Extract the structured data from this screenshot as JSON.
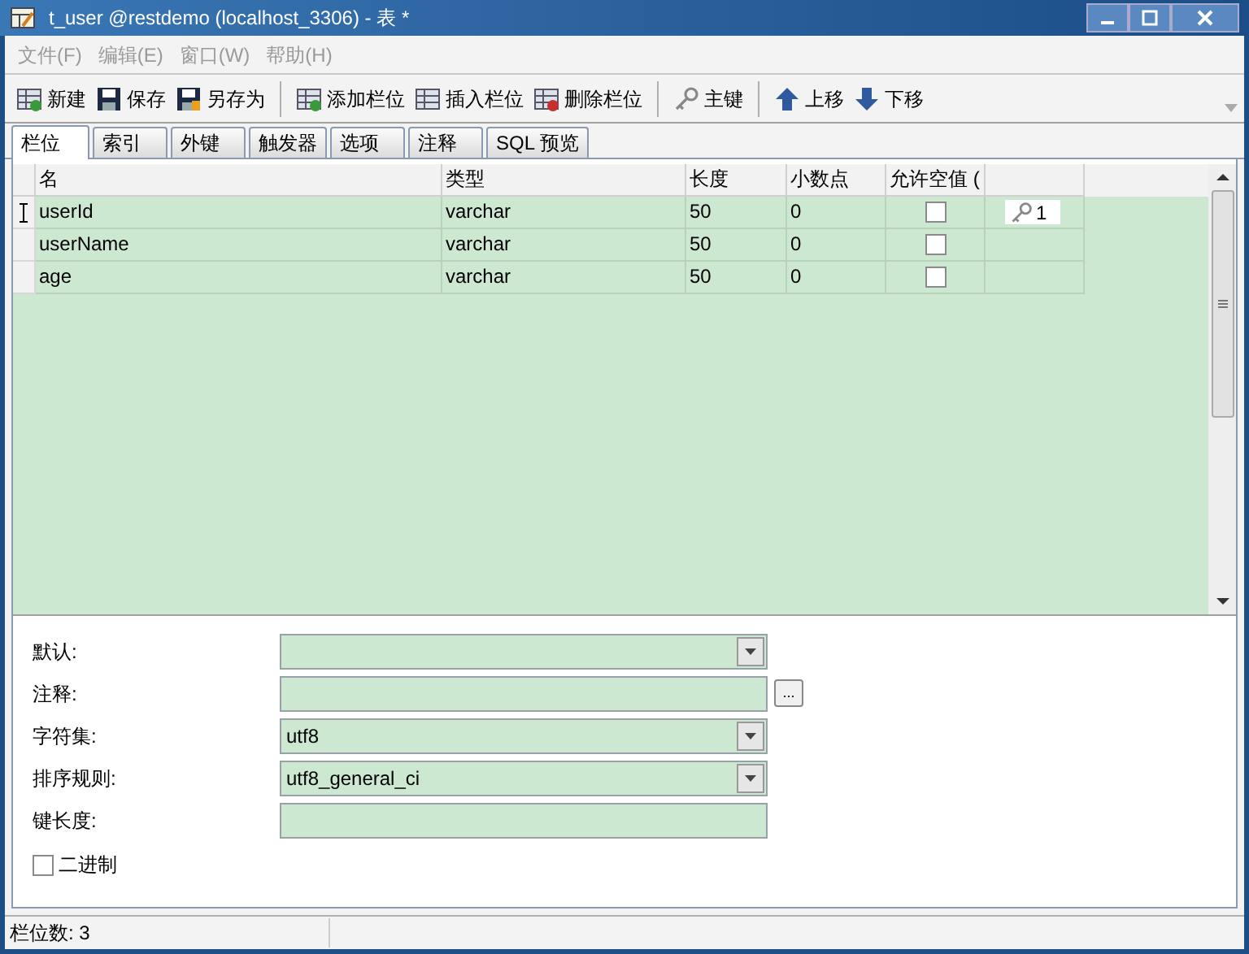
{
  "window": {
    "title": "t_user @restdemo (localhost_3306) - 表 *"
  },
  "menu": [
    {
      "label": "文件(F)",
      "disabled": true
    },
    {
      "label": "编辑(E)",
      "disabled": true
    },
    {
      "label": "窗口(W)",
      "disabled": true
    },
    {
      "label": "帮助(H)",
      "disabled": true
    }
  ],
  "toolbar": {
    "groups": [
      [
        "新建",
        "保存",
        "另存为"
      ],
      [
        "添加栏位",
        "插入栏位",
        "删除栏位"
      ],
      [
        "主键"
      ],
      [
        "上移",
        "下移"
      ]
    ]
  },
  "tabs": [
    {
      "label": "栏位",
      "selected": true
    },
    {
      "label": "索引",
      "selected": false
    },
    {
      "label": "外键",
      "selected": false
    },
    {
      "label": "触发器",
      "selected": false
    },
    {
      "label": "选项",
      "selected": false
    },
    {
      "label": "注释",
      "selected": false
    },
    {
      "label": "SQL 预览",
      "selected": false
    }
  ],
  "table": {
    "columns": [
      "名",
      "类型",
      "长度",
      "小数点",
      "允许空值 (",
      ""
    ],
    "rows": [
      {
        "current": true,
        "name": "userId",
        "type": "varchar",
        "length": "50",
        "decimals": "0",
        "nullable": false,
        "key": "1"
      },
      {
        "current": false,
        "name": "userName",
        "type": "varchar",
        "length": "50",
        "decimals": "0",
        "nullable": false
      },
      {
        "current": false,
        "name": "age",
        "type": "varchar",
        "length": "50",
        "decimals": "0",
        "nullable": false
      }
    ]
  },
  "form": [
    {
      "kind": "combo",
      "label": "默认:"
    },
    {
      "kind": "text-button",
      "label": "注释:",
      "button": "..."
    },
    {
      "kind": "combo",
      "label": "字符集:",
      "value": "utf8"
    },
    {
      "kind": "combo",
      "label": "排序规则:",
      "value": "utf8_general_ci"
    },
    {
      "kind": "text",
      "label": "键长度:"
    }
  ],
  "binary": {
    "label": "二进制",
    "checked": false
  },
  "status_bar": {
    "text": "栏位数: 3"
  }
}
